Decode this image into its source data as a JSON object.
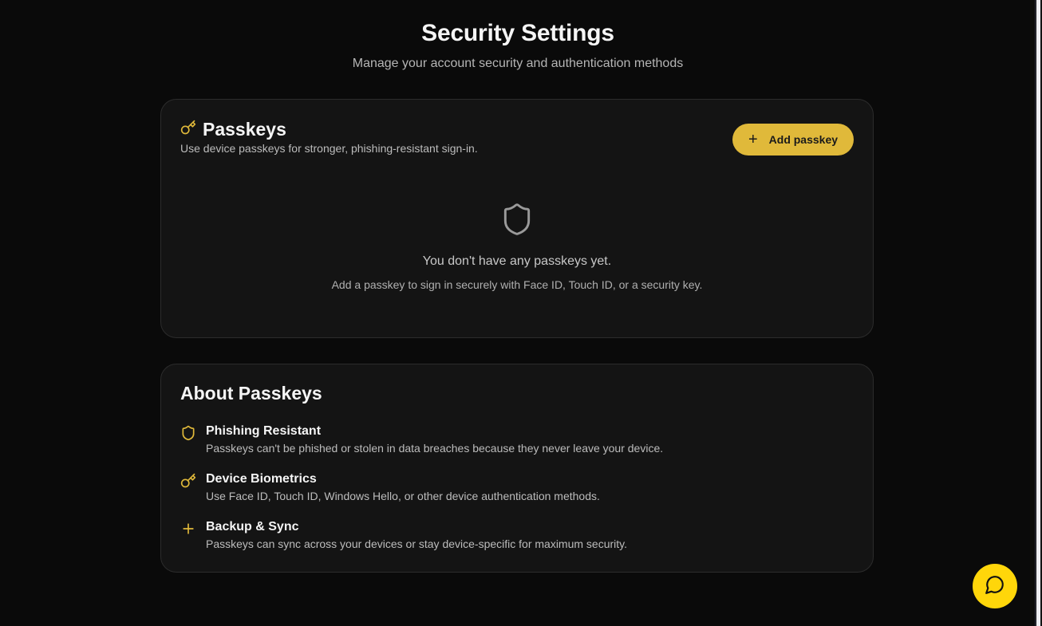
{
  "header": {
    "title": "Security Settings",
    "subtitle": "Manage your account security and authentication methods"
  },
  "passkeys": {
    "title": "Passkeys",
    "description": "Use device passkeys for stronger, phishing-resistant sign-in.",
    "add_label": "Add passkey",
    "empty_title": "You don't have any passkeys yet.",
    "empty_description": "Add a passkey to sign in securely with Face ID, Touch ID, or a security key."
  },
  "about": {
    "title": "About Passkeys",
    "features": [
      {
        "icon": "shield-icon",
        "name": "Phishing Resistant",
        "description": "Passkeys can't be phished or stolen in data breaches because they never leave your device."
      },
      {
        "icon": "key-icon",
        "name": "Device Biometrics",
        "description": "Use Face ID, Touch ID, Windows Hello, or other device authentication methods."
      },
      {
        "icon": "plus-icon",
        "name": "Backup & Sync",
        "description": "Passkeys can sync across your devices or stay device-specific for maximum security."
      }
    ]
  },
  "chat": {
    "icon": "chat-bubble-icon"
  },
  "colors": {
    "accent": "#e0b93a",
    "fab": "#ffd60a",
    "background": "#0a0a0a",
    "card": "#141414"
  }
}
